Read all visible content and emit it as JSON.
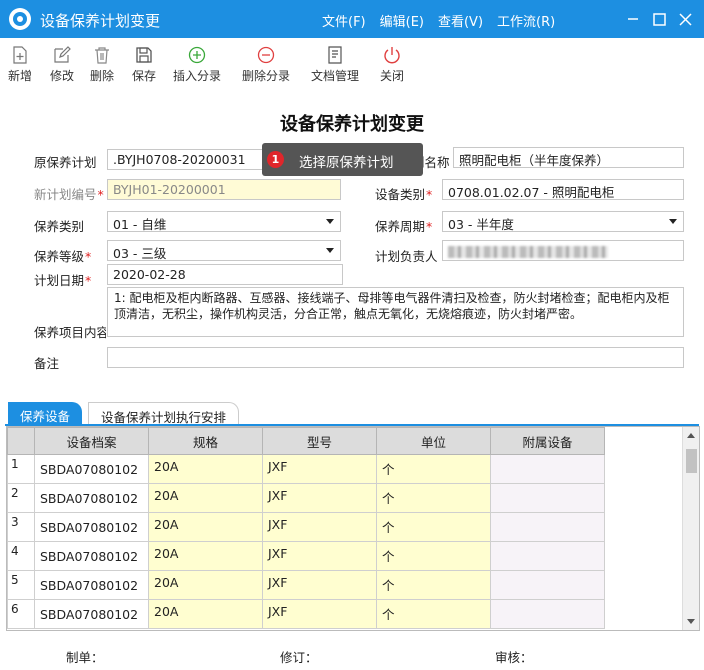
{
  "window": {
    "title": "设备保养计划变更",
    "menu": [
      "文件(F)",
      "编辑(E)",
      "查看(V)",
      "工作流(R)"
    ]
  },
  "toolbar": [
    {
      "label": "新增",
      "icon": "plus-doc-icon"
    },
    {
      "label": "修改",
      "icon": "edit-icon"
    },
    {
      "label": "删除",
      "icon": "trash-icon"
    },
    {
      "label": "保存",
      "icon": "save-icon"
    },
    {
      "label": "插入分录",
      "icon": "insert-row-icon"
    },
    {
      "label": "删除分录",
      "icon": "delete-row-icon"
    },
    {
      "label": "文档管理",
      "icon": "document-icon"
    },
    {
      "label": "关闭",
      "icon": "power-icon"
    }
  ],
  "form": {
    "title": "设备保养计划变更",
    "orig_plan_label": "原保养计划",
    "orig_plan_value": ".BYJH0708-20200031",
    "plan_name_label": "划名称",
    "plan_name_value": "照明配电柜（半年度保养）",
    "new_plan_no_label": "新计划编号",
    "new_plan_no_value": "BYJH01-20200001",
    "equip_category_label": "设备类别",
    "equip_category_value": "0708.01.02.07 - 照明配电柜",
    "maint_type_label": "保养类别",
    "maint_type_value": "01 - 自维",
    "maint_cycle_label": "保养周期",
    "maint_cycle_value": "03 - 半年度",
    "maint_level_label": "保养等级",
    "maint_level_value": "03 - 三级",
    "responsible_label": "计划负责人",
    "plan_date_label": "计划日期",
    "plan_date_value": "2020-02-28",
    "items_label": "保养项目内容",
    "items_value": "1: 配电柜及柜内断路器、互感器、接线端子、母排等电气器件清扫及检查，防火封堵检查；配电柜内及柜顶清洁，无积尘，操作机构灵活，分合正常，触点无氧化，无烧熔痕迹，防火封堵严密。",
    "remark_label": "备注",
    "remark_value": ""
  },
  "tooltip": {
    "badge": "1",
    "text": "选择原保养计划"
  },
  "tabs": [
    "保养设备",
    "设备保养计划执行安排"
  ],
  "grid": {
    "columns": [
      "设备档案",
      "规格",
      "型号",
      "单位",
      "附属设备"
    ],
    "rows": [
      {
        "no": "1",
        "code": "SBDA07080102",
        "spec": "20A",
        "model": "JXF",
        "unit": "个",
        "attach": ""
      },
      {
        "no": "2",
        "code": "SBDA07080102",
        "spec": "20A",
        "model": "JXF",
        "unit": "个",
        "attach": ""
      },
      {
        "no": "3",
        "code": "SBDA07080102",
        "spec": "20A",
        "model": "JXF",
        "unit": "个",
        "attach": ""
      },
      {
        "no": "4",
        "code": "SBDA07080102",
        "spec": "20A",
        "model": "JXF",
        "unit": "个",
        "attach": ""
      },
      {
        "no": "5",
        "code": "SBDA07080102",
        "spec": "20A",
        "model": "JXF",
        "unit": "个",
        "attach": ""
      },
      {
        "no": "6",
        "code": "SBDA07080102",
        "spec": "20A",
        "model": "JXF",
        "unit": "个",
        "attach": ""
      }
    ]
  },
  "footer": {
    "maker_label": "制单：",
    "reviser_label": "修订：",
    "auditor_label": "审核："
  },
  "colors": {
    "accent": "#1d8fe1",
    "highlight": "#fffed0",
    "required": "#e02020"
  }
}
